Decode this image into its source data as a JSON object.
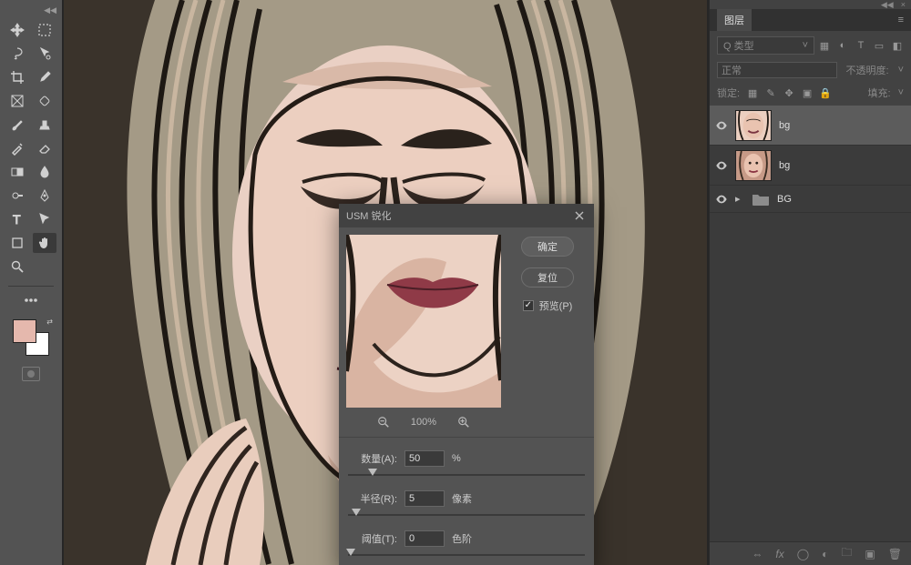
{
  "dialog": {
    "title": "USM 锐化",
    "ok": "确定",
    "reset": "复位",
    "preview_label": "预览(P)",
    "zoom_level": "100%",
    "params": {
      "amount_label": "数量(A):",
      "amount_value": "50",
      "amount_unit": "%",
      "radius_label": "半径(R):",
      "radius_value": "5",
      "radius_unit": "像素",
      "threshold_label": "阈值(T):",
      "threshold_value": "0",
      "threshold_unit": "色阶"
    }
  },
  "layers_panel": {
    "title": "图层",
    "search_placeholder": "Q 类型",
    "blend_label": "正常",
    "opacity_label": "不透明度:",
    "lock_label": "锁定:",
    "fill_label": "填充:",
    "layers": [
      {
        "name": "bg",
        "selected": true,
        "type": "image"
      },
      {
        "name": "bg",
        "selected": false,
        "type": "image"
      },
      {
        "name": "BG",
        "selected": false,
        "type": "group"
      }
    ]
  },
  "colors": {
    "foreground": "#e5b8ad",
    "background": "#ffffff"
  }
}
